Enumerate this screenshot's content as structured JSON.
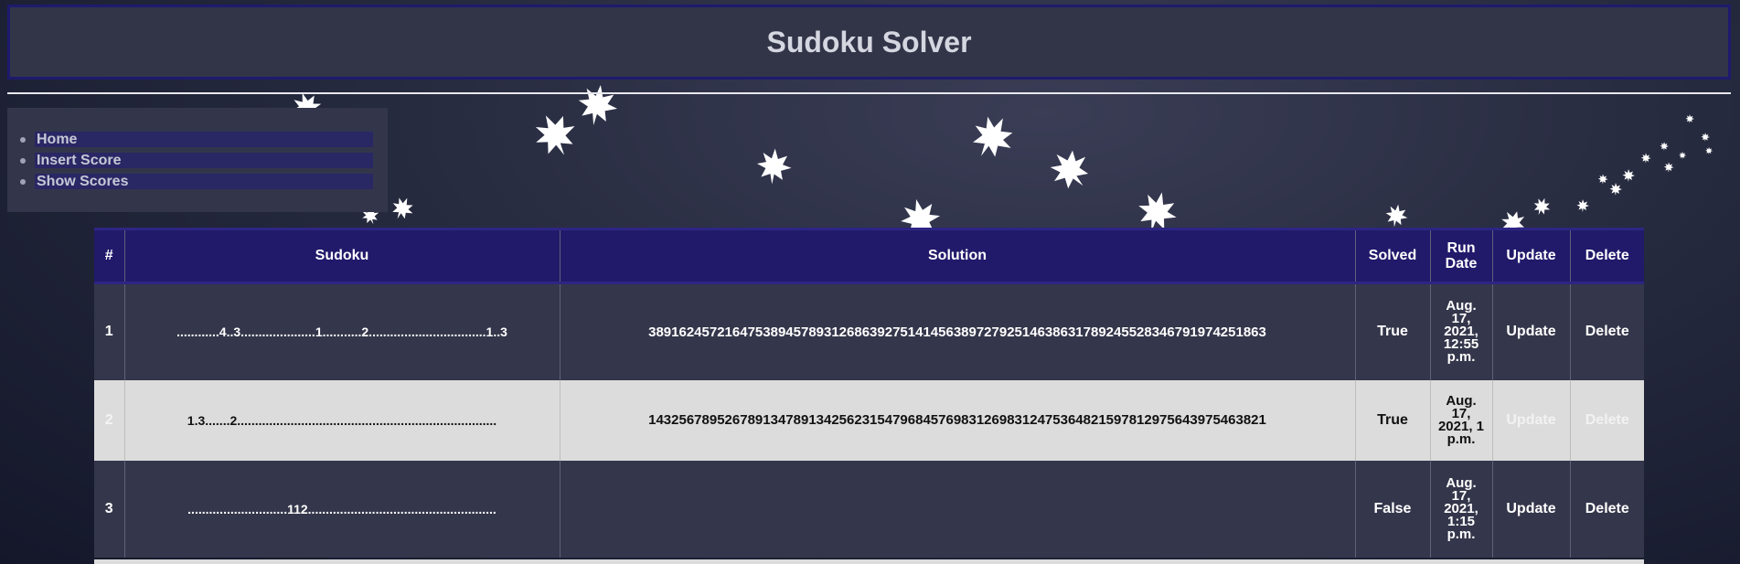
{
  "header": {
    "title": "Sudoku Solver"
  },
  "nav": {
    "items": [
      {
        "label": "Home"
      },
      {
        "label": "Insert Score"
      },
      {
        "label": "Show Scores"
      }
    ]
  },
  "table": {
    "columns": [
      "#",
      "Sudoku",
      "Solution",
      "Solved",
      "Run Date",
      "Update",
      "Delete"
    ],
    "rows": [
      {
        "id": "1",
        "sudoku": "............4..3.....................1...........2.................................1..3",
        "solution": "389162457216475389457893126863927514145638972792514638631789245528346791974251863",
        "solved": "True",
        "run_date": "Aug. 17, 2021, 12:55 p.m.",
        "update": "Update",
        "delete": "Delete"
      },
      {
        "id": "2",
        "sudoku": "1.3.......2.........................................................................",
        "solution": "143256789526789134789134256231547968457698312698312475364821597812975643975463821",
        "solved": "True",
        "run_date": "Aug. 17, 2021, 1 p.m.",
        "update": "Update",
        "delete": "Delete"
      },
      {
        "id": "3",
        "sudoku": "............................112.....................................................",
        "solution": "",
        "solved": "False",
        "run_date": "Aug. 17, 2021, 1:15 p.m.",
        "update": "Update",
        "delete": "Delete"
      }
    ]
  },
  "colors": {
    "header_bg": "#323548",
    "nav_link_bg": "#2a2765",
    "table_head_bg": "#211a6b",
    "row_dark": "#34374b",
    "row_light": "#dcdcdc"
  }
}
